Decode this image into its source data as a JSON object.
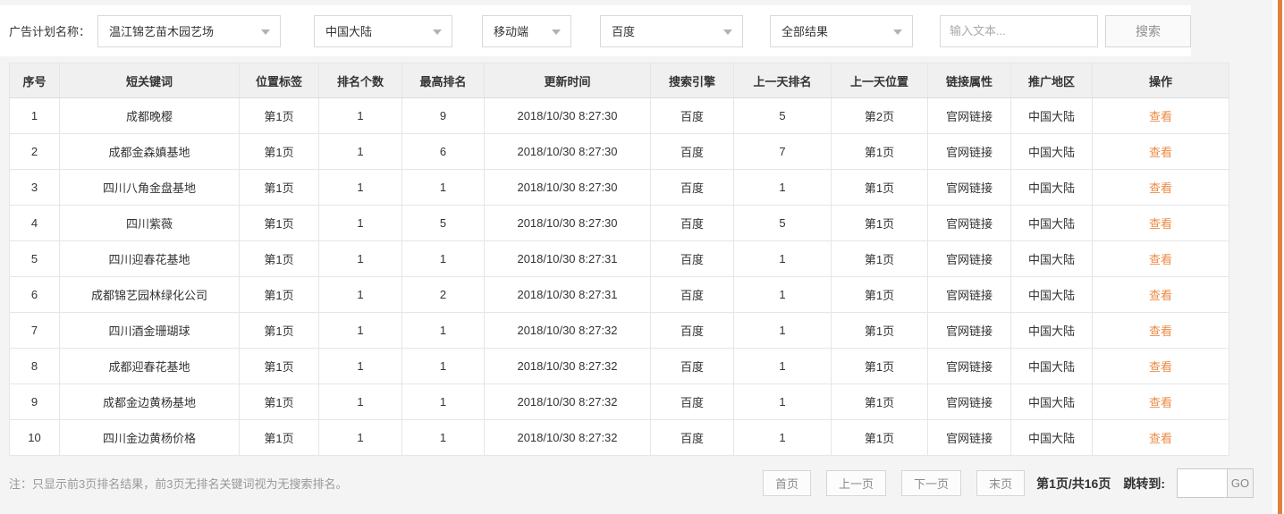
{
  "filters": {
    "label": "广告计划名称：",
    "plan_selected": "温江锦艺苗木园艺场",
    "region_selected": "中国大陆",
    "device_selected": "移动端",
    "engine_selected": "百度",
    "result_selected": "全部结果",
    "text_placeholder": "输入文本...",
    "search_button": "搜索"
  },
  "table": {
    "headers": [
      "序号",
      "短关键词",
      "位置标签",
      "排名个数",
      "最高排名",
      "更新时间",
      "搜索引擎",
      "上一天排名",
      "上一天位置",
      "链接属性",
      "推广地区",
      "操作"
    ],
    "col_keys": [
      "index",
      "keyword",
      "position-tag",
      "rank-count",
      "best-rank",
      "update-time",
      "search-engine",
      "prev-day-rank",
      "prev-day-position",
      "link-attr",
      "promo-region"
    ],
    "action_label": "查看",
    "rows": [
      [
        "1",
        "成都晚樱",
        "第1页",
        "1",
        "9",
        "2018/10/30 8:27:30",
        "百度",
        "5",
        "第2页",
        "官网链接",
        "中国大陆"
      ],
      [
        "2",
        "成都金森嫃基地",
        "第1页",
        "1",
        "6",
        "2018/10/30 8:27:30",
        "百度",
        "7",
        "第1页",
        "官网链接",
        "中国大陆"
      ],
      [
        "3",
        "四川八角金盘基地",
        "第1页",
        "1",
        "1",
        "2018/10/30 8:27:30",
        "百度",
        "1",
        "第1页",
        "官网链接",
        "中国大陆"
      ],
      [
        "4",
        "四川紫薇",
        "第1页",
        "1",
        "5",
        "2018/10/30 8:27:30",
        "百度",
        "5",
        "第1页",
        "官网链接",
        "中国大陆"
      ],
      [
        "5",
        "四川迎春花基地",
        "第1页",
        "1",
        "1",
        "2018/10/30 8:27:31",
        "百度",
        "1",
        "第1页",
        "官网链接",
        "中国大陆"
      ],
      [
        "6",
        "成都锦艺园林绿化公司",
        "第1页",
        "1",
        "2",
        "2018/10/30 8:27:31",
        "百度",
        "1",
        "第1页",
        "官网链接",
        "中国大陆"
      ],
      [
        "7",
        "四川酒金珊瑚球",
        "第1页",
        "1",
        "1",
        "2018/10/30 8:27:32",
        "百度",
        "1",
        "第1页",
        "官网链接",
        "中国大陆"
      ],
      [
        "8",
        "成都迎春花基地",
        "第1页",
        "1",
        "1",
        "2018/10/30 8:27:32",
        "百度",
        "1",
        "第1页",
        "官网链接",
        "中国大陆"
      ],
      [
        "9",
        "成都金边黄杨基地",
        "第1页",
        "1",
        "1",
        "2018/10/30 8:27:32",
        "百度",
        "1",
        "第1页",
        "官网链接",
        "中国大陆"
      ],
      [
        "10",
        "四川金边黄杨价格",
        "第1页",
        "1",
        "1",
        "2018/10/30 8:27:32",
        "百度",
        "1",
        "第1页",
        "官网链接",
        "中国大陆"
      ]
    ]
  },
  "footer": {
    "note": "注：只显示前3页排名结果，前3页无排名关键词视为无搜索排名。",
    "pagination": {
      "first": "首页",
      "prev": "上一页",
      "next": "下一页",
      "last": "末页",
      "page_info": "第1页/共16页",
      "jump_label": "跳转到:",
      "jump_value": "",
      "go": "GO"
    }
  },
  "colors": {
    "action_link": "#ed8a45",
    "scrollbar_thumb": "#e0813f",
    "header_bg": "#f0f0f0",
    "page_bg": "#f4f4f4"
  }
}
